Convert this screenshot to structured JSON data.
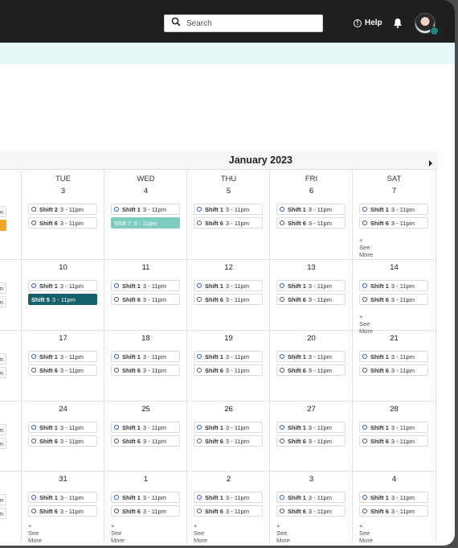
{
  "header": {
    "search_placeholder": "Search",
    "help_label": "Help",
    "help_icon_glyph": "!"
  },
  "calendar": {
    "month_title": "January 2023",
    "day_headers": [
      "TUE",
      "WED",
      "THU",
      "FRI",
      "SAT"
    ],
    "see_more_label": "+ See More",
    "shift_time": "3 - 11pm",
    "left_partial_time": "m",
    "weeks": [
      {
        "days": [
          {
            "num": "3",
            "shifts": [
              {
                "name": "Shift 2",
                "time": "3 - 11pm",
                "style": "s2"
              },
              {
                "name": "Shift 6",
                "time": "3 - 11pm",
                "style": "s6"
              }
            ]
          },
          {
            "num": "4",
            "shifts": [
              {
                "name": "Shift 1",
                "time": "3 - 11pm",
                "style": "s1"
              },
              {
                "name": "Shift 7",
                "time": "3 - 11pm",
                "style": "teal"
              }
            ]
          },
          {
            "num": "5",
            "shifts": [
              {
                "name": "Shift 1",
                "time": "3 - 11pm",
                "style": "s1"
              },
              {
                "name": "Shift 6",
                "time": "3 - 11pm",
                "style": "s6"
              }
            ]
          },
          {
            "num": "6",
            "shifts": [
              {
                "name": "Shift 1",
                "time": "3 - 11pm",
                "style": "s1"
              },
              {
                "name": "Shift 6",
                "time": "3 - 11pm",
                "style": "s6"
              }
            ]
          },
          {
            "num": "7",
            "shifts": [
              {
                "name": "Shift 1",
                "time": "3 - 11pm",
                "style": "s1"
              },
              {
                "name": "Shift 6",
                "time": "3 - 11pm",
                "style": "s6"
              }
            ],
            "see_more": true
          }
        ]
      },
      {
        "days": [
          {
            "num": "10",
            "shifts": [
              {
                "name": "Shift 1",
                "time": "3 - 11pm",
                "style": "s1"
              },
              {
                "name": "Shift 5",
                "time": "3 - 11pm",
                "style": "dark"
              }
            ]
          },
          {
            "num": "11",
            "shifts": [
              {
                "name": "Shift 1",
                "time": "3 - 11pm",
                "style": "s1"
              },
              {
                "name": "Shift 6",
                "time": "3 - 11pm",
                "style": "s6"
              }
            ]
          },
          {
            "num": "12",
            "shifts": [
              {
                "name": "Shift 1",
                "time": "3 - 11pm",
                "style": "s1"
              },
              {
                "name": "Shift 6",
                "time": "3 - 11pm",
                "style": "s6"
              }
            ]
          },
          {
            "num": "13",
            "shifts": [
              {
                "name": "Shift 1",
                "time": "3 - 11pm",
                "style": "s1"
              },
              {
                "name": "Shift 6",
                "time": "3 - 11pm",
                "style": "s6"
              }
            ]
          },
          {
            "num": "14",
            "shifts": [
              {
                "name": "Shift 1",
                "time": "3 - 11pm",
                "style": "s1"
              },
              {
                "name": "Shift 6",
                "time": "3 - 11pm",
                "style": "s6"
              }
            ],
            "see_more": true
          }
        ]
      },
      {
        "days": [
          {
            "num": "17",
            "shifts": [
              {
                "name": "Shift 1",
                "time": "3 - 11pm",
                "style": "s1"
              },
              {
                "name": "Shift 6",
                "time": "3 - 11pm",
                "style": "s6"
              }
            ]
          },
          {
            "num": "18",
            "shifts": [
              {
                "name": "Shift 1",
                "time": "3 - 11pm",
                "style": "s1"
              },
              {
                "name": "Shift 6",
                "time": "3 - 11pm",
                "style": "s6"
              }
            ]
          },
          {
            "num": "19",
            "shifts": [
              {
                "name": "Shift 1",
                "time": "3 - 11pm",
                "style": "s1"
              },
              {
                "name": "Shift 6",
                "time": "3 - 11pm",
                "style": "s6"
              }
            ]
          },
          {
            "num": "20",
            "shifts": [
              {
                "name": "Shift 1",
                "time": "3 - 11pm",
                "style": "s1"
              },
              {
                "name": "Shift 6",
                "time": "3 - 11pm",
                "style": "s6"
              }
            ]
          },
          {
            "num": "21",
            "shifts": [
              {
                "name": "Shift 1",
                "time": "3 - 11pm",
                "style": "s1"
              },
              {
                "name": "Shift 6",
                "time": "3 - 11pm",
                "style": "s6"
              }
            ]
          }
        ]
      },
      {
        "days": [
          {
            "num": "24",
            "shifts": [
              {
                "name": "Shift 1",
                "time": "3 - 11pm",
                "style": "s1"
              },
              {
                "name": "Shift 6",
                "time": "3 - 11pm",
                "style": "s6"
              }
            ]
          },
          {
            "num": "25",
            "shifts": [
              {
                "name": "Shift 1",
                "time": "3 - 11pm",
                "style": "s1"
              },
              {
                "name": "Shift 6",
                "time": "3 - 11pm",
                "style": "s6"
              }
            ]
          },
          {
            "num": "26",
            "shifts": [
              {
                "name": "Shift 1",
                "time": "3 - 11pm",
                "style": "s1"
              },
              {
                "name": "Shift 6",
                "time": "3 - 11pm",
                "style": "s6"
              }
            ]
          },
          {
            "num": "27",
            "shifts": [
              {
                "name": "Shift 1",
                "time": "3 - 11pm",
                "style": "s1"
              },
              {
                "name": "Shift 6",
                "time": "3 - 11pm",
                "style": "s6"
              }
            ]
          },
          {
            "num": "28",
            "shifts": [
              {
                "name": "Shift 1",
                "time": "3 - 11pm",
                "style": "s1"
              },
              {
                "name": "Shift 6",
                "time": "3 - 11pm",
                "style": "s6"
              }
            ]
          }
        ]
      },
      {
        "days": [
          {
            "num": "31",
            "shifts": [
              {
                "name": "Shift 1",
                "time": "3 - 11pm",
                "style": "s1"
              },
              {
                "name": "Shift 6",
                "time": "3 - 11pm",
                "style": "s6"
              }
            ],
            "see_more": true
          },
          {
            "num": "1",
            "shifts": [
              {
                "name": "Shift 1",
                "time": "3 - 11pm",
                "style": "s1"
              },
              {
                "name": "Shift 6",
                "time": "3 - 11pm",
                "style": "s6"
              }
            ],
            "see_more": true
          },
          {
            "num": "2",
            "shifts": [
              {
                "name": "Shift 1",
                "time": "3 - 11pm",
                "style": "s1"
              },
              {
                "name": "Shift 6",
                "time": "3 - 11pm",
                "style": "s6"
              }
            ],
            "see_more": true
          },
          {
            "num": "3",
            "shifts": [
              {
                "name": "Shift 1",
                "time": "3 - 11pm",
                "style": "s1"
              },
              {
                "name": "Shift 6",
                "time": "3 - 11pm",
                "style": "s6"
              }
            ],
            "see_more": true
          },
          {
            "num": "4",
            "shifts": [
              {
                "name": "Shift 1",
                "time": "3 - 11pm",
                "style": "s1"
              },
              {
                "name": "Shift 6",
                "time": "3 - 11pm",
                "style": "s6"
              }
            ],
            "see_more": true
          }
        ]
      }
    ]
  },
  "colors": {
    "topbar": "#1f1f1f",
    "banner": "#e7f8f8",
    "teal_shift": "#7ecdc0",
    "dark_shift": "#15606a",
    "orange_shift": "#f5a623",
    "shift1_ring": "#2a5bd7"
  }
}
